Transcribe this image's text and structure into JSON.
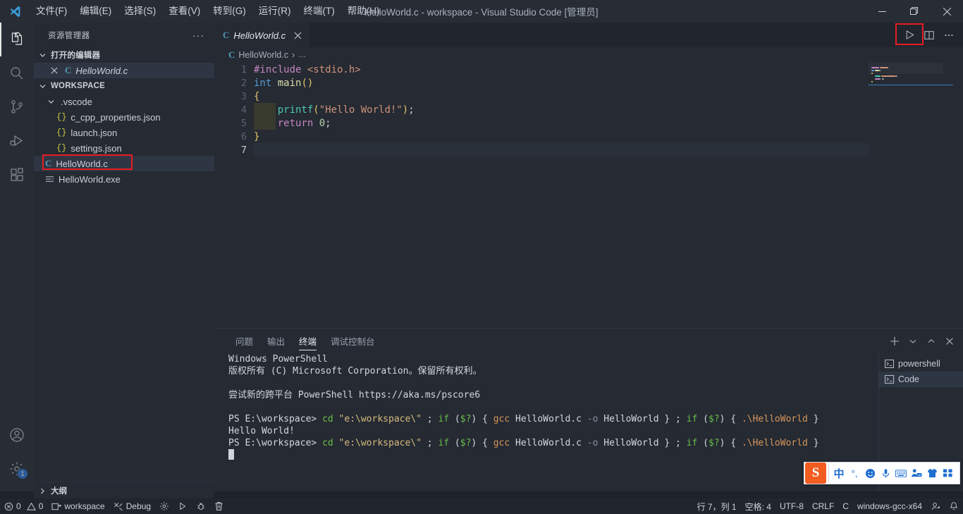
{
  "window": {
    "title": "HelloWorld.c - workspace - Visual Studio Code [管理员]",
    "logo_name": "vscode-logo",
    "minimize": "─",
    "restore": "❐",
    "close": "✕"
  },
  "menu": {
    "items": [
      {
        "label": "文件(F)"
      },
      {
        "label": "编辑(E)"
      },
      {
        "label": "选择(S)"
      },
      {
        "label": "查看(V)"
      },
      {
        "label": "转到(G)"
      },
      {
        "label": "运行(R)"
      },
      {
        "label": "终端(T)"
      },
      {
        "label": "帮助(H)"
      }
    ]
  },
  "activitybar": {
    "items": [
      {
        "name": "explorer-icon",
        "active": true
      },
      {
        "name": "search-icon",
        "active": false
      },
      {
        "name": "source-control-icon",
        "active": false
      },
      {
        "name": "run-and-debug-icon",
        "active": false
      },
      {
        "name": "extensions-icon",
        "active": false
      }
    ],
    "account_icon": "account-icon",
    "settings_icon": "gear-icon",
    "settings_badge": "1"
  },
  "sidebar": {
    "title": "资源管理器",
    "more_actions": "···",
    "open_editors": {
      "label": "打开的编辑器",
      "expanded": true,
      "items": [
        {
          "label": "HelloWorld.c",
          "icon": "c-file-icon",
          "italic": true,
          "selected": true,
          "close": "✕"
        }
      ]
    },
    "workspace": {
      "label": "WORKSPACE",
      "expanded": true,
      "items": [
        {
          "label": ".vscode",
          "icon": "folder-icon",
          "indent": 1,
          "type": "folder",
          "expanded": true
        },
        {
          "label": "c_cpp_properties.json",
          "icon": "json-icon",
          "indent": 2,
          "type": "json"
        },
        {
          "label": "launch.json",
          "icon": "json-icon",
          "indent": 2,
          "type": "json"
        },
        {
          "label": "settings.json",
          "icon": "json-icon",
          "indent": 2,
          "type": "json"
        },
        {
          "label": "HelloWorld.c",
          "icon": "c-file-icon",
          "indent": 1,
          "type": "c",
          "selected": true,
          "highlighted": true
        },
        {
          "label": "HelloWorld.exe",
          "icon": "binary-icon",
          "indent": 1,
          "type": "exe"
        }
      ]
    },
    "outline": {
      "label": "大纲",
      "expanded": false
    }
  },
  "editor": {
    "tab": {
      "label": "HelloWorld.c",
      "icon": "c-file-icon",
      "close": "✕",
      "italic": true
    },
    "actions": [
      {
        "name": "run-code-button",
        "highlighted": true
      },
      {
        "name": "split-editor-button",
        "highlighted": false
      },
      {
        "name": "more-actions-button",
        "highlighted": false
      }
    ],
    "breadcrumb": {
      "file": "HelloWorld.c",
      "separator": "›",
      "more": "…"
    },
    "line_numbers": [
      "1",
      "2",
      "3",
      "4",
      "5",
      "6",
      "7"
    ],
    "current_line": 7,
    "code_lines": [
      {
        "n": 1,
        "tokens": [
          {
            "t": "#include ",
            "c": "t-pre"
          },
          {
            "t": "<stdio.h>",
            "c": "t-inc"
          }
        ]
      },
      {
        "n": 2,
        "tokens": [
          {
            "t": "int ",
            "c": "t-type"
          },
          {
            "t": "main",
            "c": "t-fn"
          },
          {
            "t": "()",
            "c": "t-paren1"
          }
        ]
      },
      {
        "n": 3,
        "tokens": [
          {
            "t": "{",
            "c": "t-brace"
          }
        ]
      },
      {
        "n": 4,
        "tokens": [
          {
            "t": "    ",
            "c": "t-punc"
          },
          {
            "t": "printf",
            "c": "t-call"
          },
          {
            "t": "(",
            "c": "t-paren1"
          },
          {
            "t": "\"Hello World!\"",
            "c": "t-str"
          },
          {
            "t": ")",
            "c": "t-paren1"
          },
          {
            "t": ";",
            "c": "t-punc"
          }
        ]
      },
      {
        "n": 5,
        "tokens": [
          {
            "t": "    ",
            "c": "t-punc"
          },
          {
            "t": "return ",
            "c": "t-kw"
          },
          {
            "t": "0",
            "c": "t-num"
          },
          {
            "t": ";",
            "c": "t-punc"
          }
        ]
      },
      {
        "n": 6,
        "tokens": [
          {
            "t": "}",
            "c": "t-brace"
          }
        ]
      },
      {
        "n": 7,
        "tokens": []
      }
    ]
  },
  "panel": {
    "tabs": [
      {
        "label": "问题",
        "active": false
      },
      {
        "label": "输出",
        "active": false
      },
      {
        "label": "终端",
        "active": true
      },
      {
        "label": "调试控制台",
        "active": false
      }
    ],
    "actions": [
      {
        "name": "new-terminal-button",
        "glyph": "+"
      },
      {
        "name": "chevron-down-icon",
        "glyph": "⌄"
      },
      {
        "name": "maximize-panel-icon",
        "glyph": "⌃"
      },
      {
        "name": "close-panel-icon",
        "glyph": "✕"
      }
    ],
    "terminal_lines": [
      [
        {
          "t": "Windows PowerShell",
          "c": "tc-white"
        }
      ],
      [
        {
          "t": "版权所有 (C) Microsoft Corporation。保留所有权利。",
          "c": "tc-white"
        }
      ],
      [
        {
          "t": " ",
          "c": "tc-white"
        }
      ],
      [
        {
          "t": "尝试新的跨平台 PowerShell https://aka.ms/pscore6",
          "c": "tc-white"
        }
      ],
      [
        {
          "t": " ",
          "c": "tc-white"
        }
      ],
      [
        {
          "t": "PS E:\\workspace> ",
          "c": "tc-white"
        },
        {
          "t": "cd ",
          "c": "tc-green"
        },
        {
          "t": "\"e:\\workspace\\\"",
          "c": "tc-yellow"
        },
        {
          "t": " ; ",
          "c": "tc-white"
        },
        {
          "t": "if ",
          "c": "tc-green"
        },
        {
          "t": "(",
          "c": "tc-white"
        },
        {
          "t": "$?",
          "c": "tc-green"
        },
        {
          "t": ") { ",
          "c": "tc-white"
        },
        {
          "t": "gcc ",
          "c": "tc-orange"
        },
        {
          "t": "HelloWorld.c ",
          "c": "tc-white"
        },
        {
          "t": "-o ",
          "c": "tc-gray"
        },
        {
          "t": "HelloWorld } ; ",
          "c": "tc-white"
        },
        {
          "t": "if ",
          "c": "tc-green"
        },
        {
          "t": "(",
          "c": "tc-white"
        },
        {
          "t": "$?",
          "c": "tc-green"
        },
        {
          "t": ") { ",
          "c": "tc-white"
        },
        {
          "t": ".\\HelloWorld",
          "c": "tc-orange"
        },
        {
          "t": " }",
          "c": "tc-white"
        }
      ],
      [
        {
          "t": "Hello World!",
          "c": "tc-white"
        }
      ],
      [
        {
          "t": "PS E:\\workspace> ",
          "c": "tc-white"
        },
        {
          "t": "cd ",
          "c": "tc-green"
        },
        {
          "t": "\"e:\\workspace\\\"",
          "c": "tc-yellow"
        },
        {
          "t": " ; ",
          "c": "tc-white"
        },
        {
          "t": "if ",
          "c": "tc-green"
        },
        {
          "t": "(",
          "c": "tc-white"
        },
        {
          "t": "$?",
          "c": "tc-green"
        },
        {
          "t": ") { ",
          "c": "tc-white"
        },
        {
          "t": "gcc ",
          "c": "tc-orange"
        },
        {
          "t": "HelloWorld.c ",
          "c": "tc-white"
        },
        {
          "t": "-o ",
          "c": "tc-gray"
        },
        {
          "t": "HelloWorld } ; ",
          "c": "tc-white"
        },
        {
          "t": "if ",
          "c": "tc-green"
        },
        {
          "t": "(",
          "c": "tc-white"
        },
        {
          "t": "$?",
          "c": "tc-green"
        },
        {
          "t": ") { ",
          "c": "tc-white"
        },
        {
          "t": ".\\HelloWorld",
          "c": "tc-orange"
        },
        {
          "t": " }",
          "c": "tc-white"
        }
      ]
    ],
    "terminal_list": [
      {
        "label": "powershell",
        "icon": "terminal-icon",
        "active": false
      },
      {
        "label": "Code",
        "icon": "terminal-icon",
        "active": true
      }
    ]
  },
  "statusbar": {
    "left": [
      {
        "name": "problems-status",
        "icon": "error-icon",
        "label": "0",
        "icon2": "warning-icon",
        "label2": "0"
      },
      {
        "name": "remote-workspace-status",
        "icon": "remote-icon",
        "label": "workspace"
      },
      {
        "name": "debug-config-status",
        "icon": "tools-icon",
        "label": "Debug"
      },
      {
        "name": "settings-gear-status",
        "icon": "gear-icon",
        "label": ""
      },
      {
        "name": "run-status",
        "icon": "play-icon",
        "label": ""
      },
      {
        "name": "debug-status",
        "icon": "bug-icon",
        "label": ""
      },
      {
        "name": "clean-status",
        "icon": "trash-icon",
        "label": ""
      }
    ],
    "right": [
      {
        "name": "cursor-position-status",
        "label": "行 7，列 1"
      },
      {
        "name": "indentation-status",
        "label": "空格: 4"
      },
      {
        "name": "encoding-status",
        "label": "UTF-8"
      },
      {
        "name": "eol-status",
        "label": "CRLF"
      },
      {
        "name": "language-mode-status",
        "label": "C"
      },
      {
        "name": "cpp-config-status",
        "label": "windows-gcc-x64"
      },
      {
        "name": "feedback-status",
        "icon": "feedback-icon",
        "label": ""
      },
      {
        "name": "notifications-status",
        "icon": "bell-icon",
        "label": ""
      }
    ]
  },
  "ime": {
    "name": "sogou-input-toolbar",
    "logo": "S",
    "buttons": [
      {
        "name": "chinese-mode-icon",
        "glyph": "中"
      },
      {
        "name": "punctuation-mode-icon",
        "glyph": "°,"
      },
      {
        "name": "emoji-icon",
        "glyph": "☺"
      },
      {
        "name": "voice-input-icon",
        "glyph": "Ἲ4"
      },
      {
        "name": "soft-keyboard-icon",
        "glyph": "⌨"
      },
      {
        "name": "user-center-icon",
        "glyph": "♟"
      },
      {
        "name": "skin-icon",
        "glyph": "ὅ5"
      },
      {
        "name": "toolbox-icon",
        "glyph": "⬚"
      }
    ]
  },
  "colors": {
    "accent": "#2f7ad6",
    "annotation": "#e81c24",
    "titlebar_bg": "#272c35",
    "editor_bg": "#252a33",
    "statusbar_bg": "#21262e"
  }
}
